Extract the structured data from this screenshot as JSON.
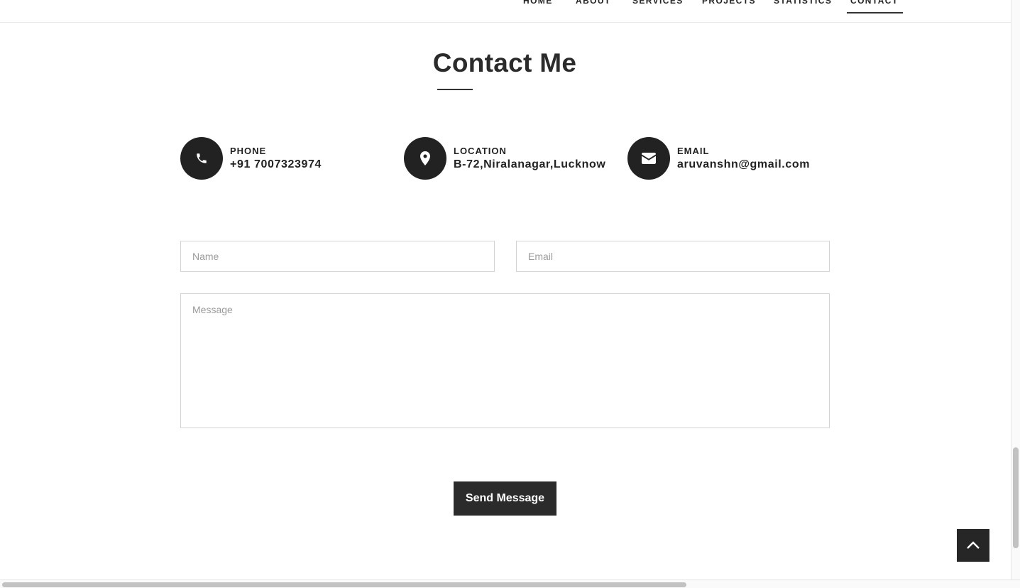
{
  "nav": {
    "items": [
      {
        "label": "HOME"
      },
      {
        "label": "ABOUT"
      },
      {
        "label": "SERVICES"
      },
      {
        "label": "PROJECTS"
      },
      {
        "label": "STATISTICS"
      },
      {
        "label": "CONTACT",
        "active": true
      }
    ]
  },
  "contact": {
    "title": "Contact Me",
    "info": [
      {
        "label": "PHONE",
        "value": "+91 7007323974",
        "icon": "phone-icon"
      },
      {
        "label": "LOCATION",
        "value": "B-72,Niralanagar,Lucknow",
        "icon": "map-marker-icon"
      },
      {
        "label": "EMAIL",
        "value": "aruvanshn@gmail.com",
        "icon": "envelope-icon"
      }
    ],
    "form": {
      "name_placeholder": "Name",
      "email_placeholder": "Email",
      "message_placeholder": "Message",
      "submit_label": "Send Message"
    }
  },
  "colors": {
    "primary_dark": "#222222",
    "button": "#2b2b2b",
    "border": "#d4d4d4",
    "placeholder": "#9a9a9a"
  }
}
